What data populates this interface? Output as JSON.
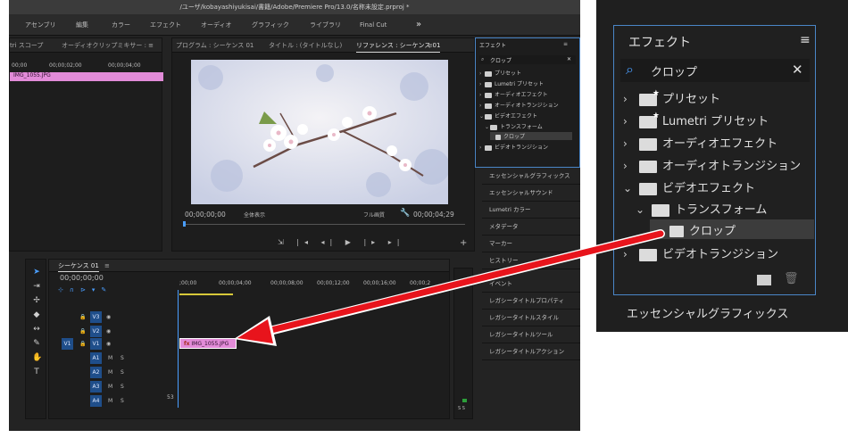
{
  "app": {
    "title": "/ユーザ/kobayashiyukisai/書籍/Adobe/Premiere Pro/13.0/名称未設定.prproj *",
    "workspaces": [
      "アセンブリ",
      "編集",
      "カラー",
      "エフェクト",
      "オーディオ",
      "グラフィック",
      "ライブラリ",
      "Final Cut"
    ],
    "more": "»"
  },
  "source_panel": {
    "tabs": [
      "tri スコープ",
      "オーディオクリップミキサー : ≡"
    ],
    "ruler": [
      "00;00",
      "00;00;02;00",
      "00;00;04;00"
    ],
    "clip": "IMG_1055.JPG"
  },
  "program_panel": {
    "tabs": [
      "プログラム : シーケンス 01",
      "タイトル : (タイトルなし)",
      "リファレンス : シーケンス 01"
    ],
    "menu_icon": "≡",
    "timecode": "00;00;00;00",
    "zoom": "全体表示",
    "quality": "フル画質",
    "duration": "00;00;04;29"
  },
  "effects_panel_small": {
    "title": "エフェクト",
    "menu": "≡",
    "search": "クロップ",
    "items": [
      "プリセット",
      "Lumetri プリセット",
      "オーディオエフェクト",
      "オーディオトランジション",
      "ビデオエフェクト",
      "トランスフォーム",
      "クロップ",
      "ビデオトランジション"
    ]
  },
  "side_panels": [
    "エッセンシャルグラフィックス",
    "エッセンシャルサウンド",
    "Lumetri カラー",
    "メタデータ",
    "マーカー",
    "ヒストリー",
    "イベント",
    "レガシータイトルプロパティ",
    "レガシータイトルスタイル",
    "レガシータイトルツール",
    "レガシータイトルアクション"
  ],
  "timeline": {
    "tab": "シーケンス 01",
    "menu": "≡",
    "timecode": "00;00;00;00",
    "ruler": [
      ";00;00",
      "00;00;04;00",
      "00;00;08;00",
      "00;00;12;00",
      "00;00;16;00",
      "00;00;2"
    ],
    "video_tracks": [
      "V3",
      "V2",
      "V1"
    ],
    "audio_tracks": [
      "A1",
      "A2",
      "A3",
      "A4"
    ],
    "source_patch": "V1",
    "m": "M",
    "s": "S",
    "clip": "IMG_1055.JPG",
    "fx": "fx",
    "vol_label": "S S",
    "mix_db": "53"
  },
  "zoom_panel": {
    "title": "エフェクト",
    "menu": "≡",
    "search": "クロップ",
    "close": "✕",
    "items": [
      "プリセット",
      "Lumetri プリセット",
      "オーディオエフェクト",
      "オーディオトランジション",
      "ビデオエフェクト",
      "トランスフォーム",
      "クロップ",
      "ビデオトランジション"
    ],
    "below": "エッセンシャルグラフィックス"
  },
  "colors": {
    "accent": "#4a9eff",
    "clip": "#e28bd8",
    "arrow": "#e8141c",
    "highlight": "#3c3c3c"
  }
}
